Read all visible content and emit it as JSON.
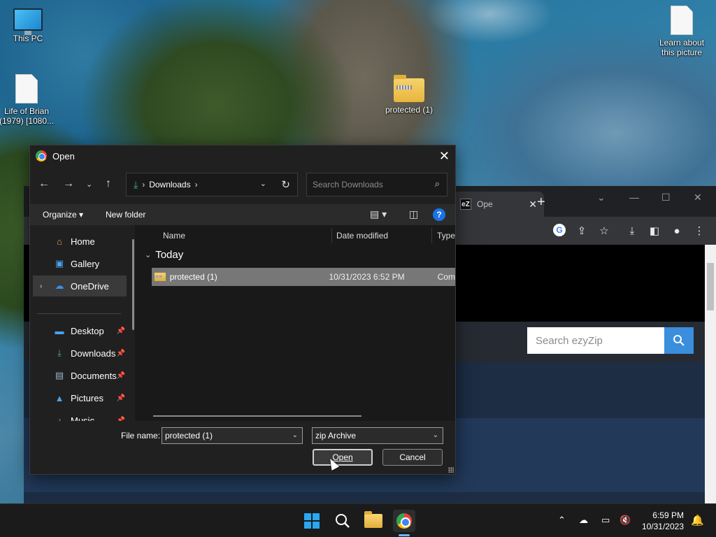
{
  "desktop": {
    "icons": [
      {
        "label": "This PC"
      },
      {
        "label": "Life of Brian (1979) [1080..."
      },
      {
        "label": "protected (1)"
      },
      {
        "label": "Learn about this picture"
      }
    ]
  },
  "browser": {
    "tab_title": "Ope",
    "tab_favicon_text": "eZ",
    "site_search_placeholder": "Search ezyZip"
  },
  "dialog": {
    "title": "Open",
    "address": {
      "location": "Downloads"
    },
    "search_placeholder": "Search Downloads",
    "commands": {
      "organize": "Organize",
      "new_folder": "New folder"
    },
    "sidebar": {
      "home": "Home",
      "gallery": "Gallery",
      "onedrive": "OneDrive",
      "desktop": "Desktop",
      "downloads": "Downloads",
      "documents": "Documents",
      "pictures": "Pictures",
      "music": "Music"
    },
    "columns": {
      "name": "Name",
      "date_modified": "Date modified",
      "type": "Type"
    },
    "group_label": "Today",
    "files": [
      {
        "name": "protected (1)",
        "date": "10/31/2023 6:52 PM",
        "type": "Com"
      }
    ],
    "file_name_label": "File name:",
    "file_name_value": "protected (1)",
    "file_type_value": "zip Archive",
    "open_label": "Open",
    "cancel_label": "Cancel"
  },
  "taskbar": {
    "time": "6:59 PM",
    "date": "10/31/2023"
  }
}
